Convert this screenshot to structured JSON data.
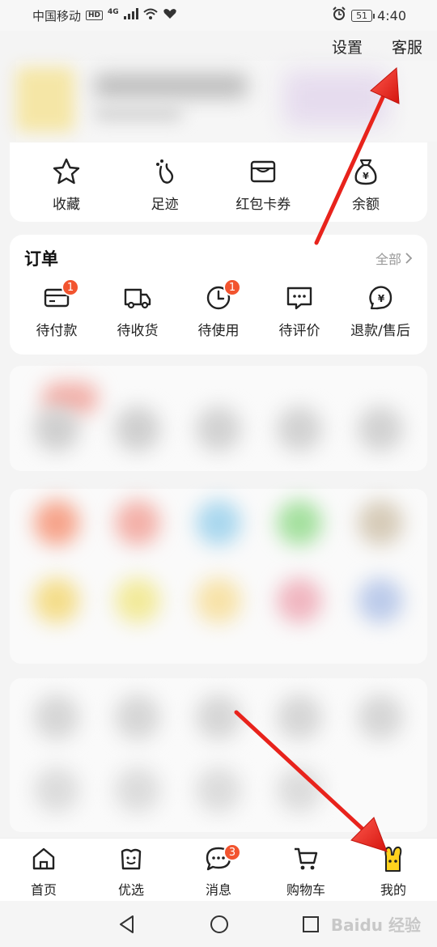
{
  "status_bar": {
    "carrier": "中国移动",
    "hd": "HD",
    "network": "4G",
    "battery": "51",
    "time": "4:40"
  },
  "top_links": {
    "settings": "设置",
    "customer_service": "客服"
  },
  "quick_actions": [
    {
      "label": "收藏",
      "icon": "star-icon"
    },
    {
      "label": "足迹",
      "icon": "footprint-icon"
    },
    {
      "label": "红包卡券",
      "icon": "wallet-icon"
    },
    {
      "label": "余额",
      "icon": "money-bag-icon"
    }
  ],
  "orders": {
    "title": "订单",
    "all_label": "全部",
    "items": [
      {
        "label": "待付款",
        "icon": "card-icon",
        "badge": "1"
      },
      {
        "label": "待收货",
        "icon": "truck-icon",
        "badge": ""
      },
      {
        "label": "待使用",
        "icon": "clock-icon",
        "badge": "1"
      },
      {
        "label": "待评价",
        "icon": "comment-icon",
        "badge": ""
      },
      {
        "label": "退款/售后",
        "icon": "refund-icon",
        "badge": ""
      }
    ]
  },
  "tabs": [
    {
      "label": "首页",
      "icon": "home-icon",
      "badge": ""
    },
    {
      "label": "优选",
      "icon": "select-bag-icon",
      "badge": ""
    },
    {
      "label": "消息",
      "icon": "message-icon",
      "badge": "3"
    },
    {
      "label": "购物车",
      "icon": "cart-icon",
      "badge": ""
    },
    {
      "label": "我的",
      "icon": "mascot-icon",
      "badge": ""
    }
  ],
  "watermark": "Baidu 经验",
  "colors": {
    "badge": "#f2542f",
    "arrow": "#e8231c",
    "accent_yellow": "#ffd21e"
  }
}
